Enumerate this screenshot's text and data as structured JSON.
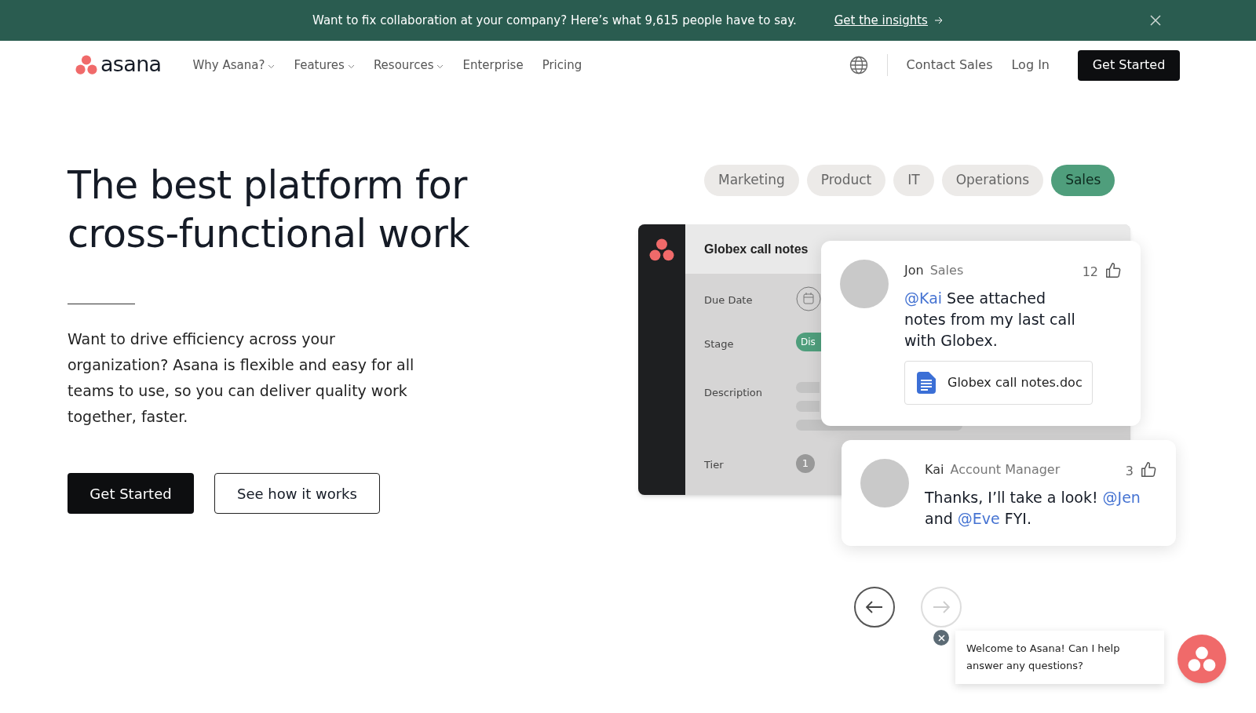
{
  "banner": {
    "text": "Want to fix collaboration at your company? Here’s what 9,615 people have to say.",
    "link": "Get the insights"
  },
  "nav": {
    "logo": "asana",
    "items": [
      {
        "label": "Why Asana?",
        "dropdown": true
      },
      {
        "label": "Features",
        "dropdown": true
      },
      {
        "label": "Resources",
        "dropdown": true
      },
      {
        "label": "Enterprise",
        "dropdown": false
      },
      {
        "label": "Pricing",
        "dropdown": false
      }
    ],
    "right_links": [
      "Contact Sales",
      "Log In"
    ],
    "cta": "Get Started"
  },
  "hero": {
    "title_lines": [
      "The best platform for",
      "cross-functional work"
    ],
    "paragraph": "Want to drive efficiency across your organization? Asana is flexible and easy for all teams to use, so you can deliver quality work together, faster.",
    "primary_button": "Get Started",
    "secondary_button": "See how it works"
  },
  "team_tabs": [
    {
      "label": "Marketing",
      "selected": false
    },
    {
      "label": "Product",
      "selected": false
    },
    {
      "label": "IT",
      "selected": false
    },
    {
      "label": "Operations",
      "selected": false
    },
    {
      "label": "Sales",
      "selected": true
    }
  ],
  "task": {
    "title": "Globex call notes",
    "fields": [
      {
        "label": "Due Date",
        "kind": "date"
      },
      {
        "label": "Stage",
        "kind": "pill",
        "value": "Dis"
      },
      {
        "label": "Description",
        "kind": "lines"
      },
      {
        "label": "Tier",
        "kind": "badge",
        "value": "1"
      }
    ]
  },
  "comments": [
    {
      "name": "Jon",
      "role": "Sales",
      "likes": "12",
      "message": [
        {
          "kind": "mention",
          "text": "@Kai"
        },
        {
          "kind": "text",
          "text": " See attached notes from my last call with Globex."
        }
      ],
      "attachment": "Globex call notes.doc"
    },
    {
      "name": "Kai",
      "role": "Account Manager",
      "likes": "3",
      "message": [
        {
          "kind": "text",
          "text": "Thanks, I’ll take a look! "
        },
        {
          "kind": "mention",
          "text": "@Jen"
        },
        {
          "kind": "text",
          "text": " and "
        },
        {
          "kind": "mention",
          "text": "@Eve"
        },
        {
          "kind": "text",
          "text": " FYI."
        }
      ]
    }
  ],
  "carousel": {
    "prev_disabled": false,
    "next_disabled": true
  },
  "chat": {
    "message": "Welcome to Asana! Can I help answer any questions?"
  }
}
